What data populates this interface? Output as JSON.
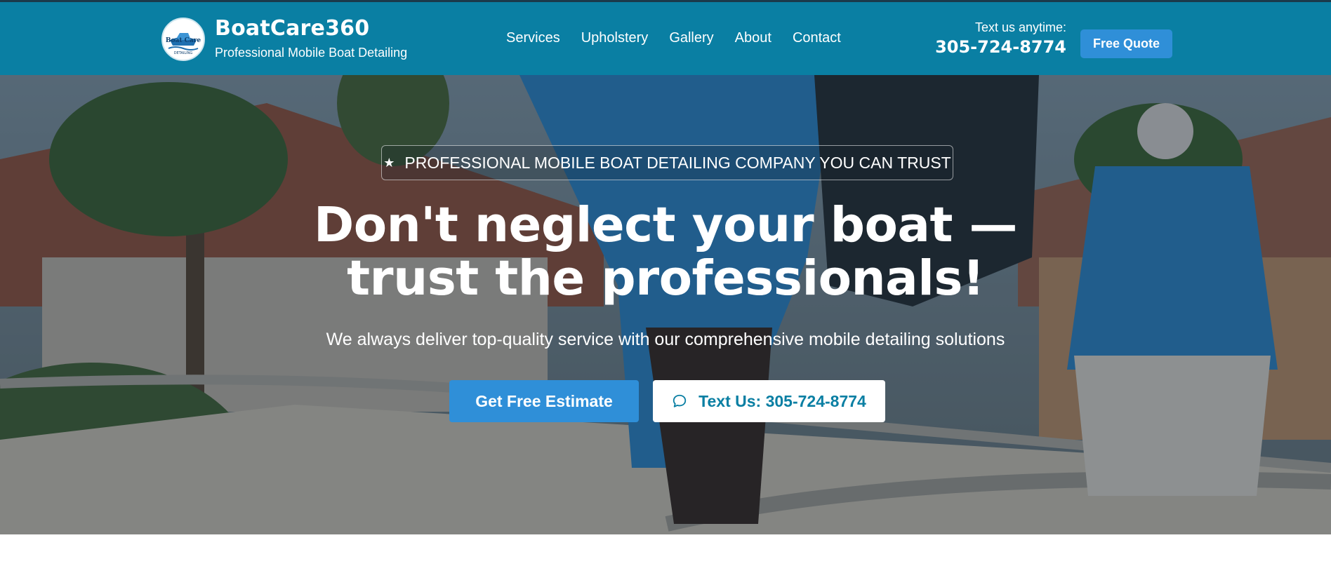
{
  "header": {
    "brand_name": "BoatCare360",
    "tagline": "Professional Mobile Boat Detailing",
    "logo_text_top": "Boat Care",
    "logo_text_bottom": "DETAILING",
    "nav": [
      {
        "label": "Services"
      },
      {
        "label": "Upholstery"
      },
      {
        "label": "Gallery"
      },
      {
        "label": "About"
      },
      {
        "label": "Contact"
      }
    ],
    "text_label": "Text us anytime:",
    "phone": "305-724-8774",
    "quote_button": "Free Quote",
    "background_color": "#0a7fa3"
  },
  "hero": {
    "badge_text": "PROFESSIONAL MOBILE BOAT DETAILING COMPANY YOU CAN TRUST",
    "badge_icon": "star-icon",
    "headline_line1": "Don't neglect your boat —",
    "headline_line2": "trust the professionals!",
    "subheadline": "We always deliver top-quality service with our comprehensive mobile detailing solutions",
    "primary_button": "Get Free Estimate",
    "secondary_button": "Text Us: 305-724-8774",
    "secondary_icon": "chat-bubble-icon",
    "accent_color": "#2f8fd8"
  }
}
